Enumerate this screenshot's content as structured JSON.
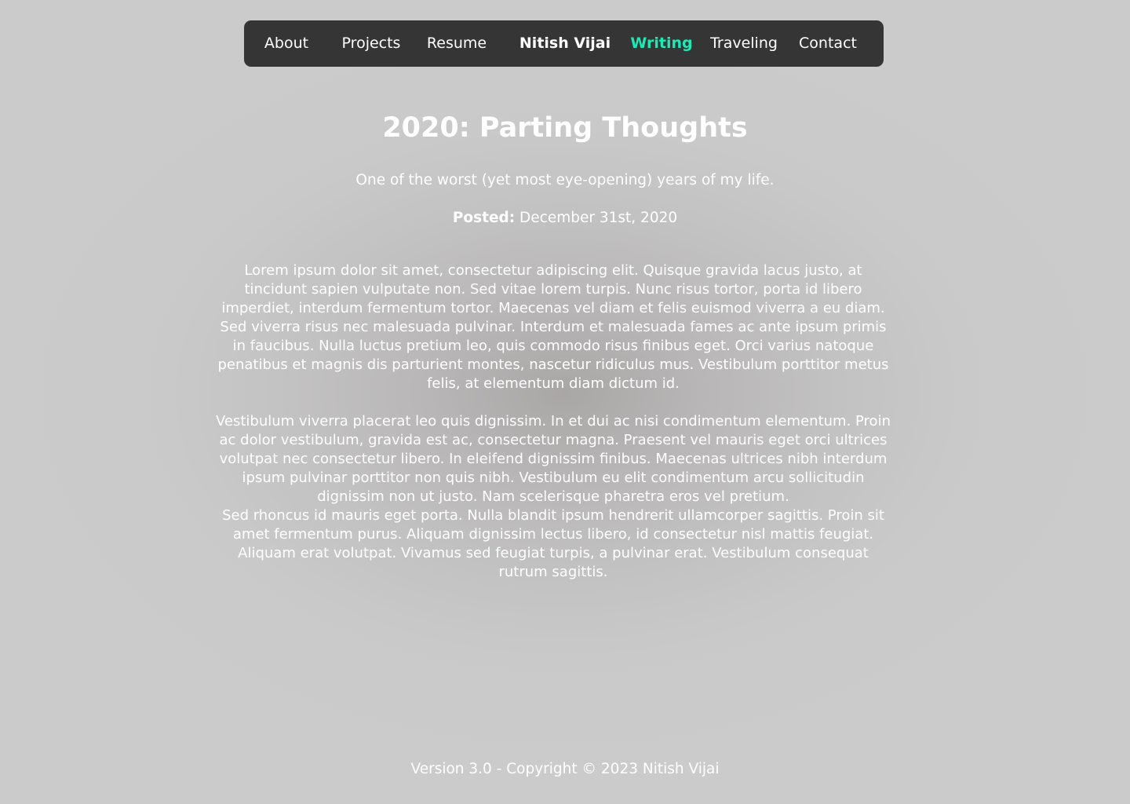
{
  "nav": {
    "items": [
      {
        "label": "About"
      },
      {
        "label": "Projects"
      },
      {
        "label": "Resume"
      },
      {
        "label": "Nitish Vijai"
      },
      {
        "label": "Writing"
      },
      {
        "label": "Traveling"
      },
      {
        "label": "Contact"
      }
    ],
    "active_label": "Writing",
    "active_color": "#1de9b6"
  },
  "article": {
    "title": "2020: Parting Thoughts",
    "subtitle": "One of the worst (yet most eye-opening) years of my life.",
    "posted_label": "Posted:",
    "posted_date": "December 31st, 2020",
    "paragraphs": [
      "Lorem ipsum dolor sit amet, consectetur adipiscing elit. Quisque gravida lacus justo, at tincidunt sapien vulputate non. Sed vitae lorem turpis. Nunc risus tortor, porta id libero imperdiet, interdum fermentum tortor. Maecenas vel diam et felis euismod viverra a eu diam. Sed viverra risus nec malesuada pulvinar. Interdum et malesuada fames ac ante ipsum primis in faucibus. Nulla luctus pretium leo, quis commodo risus finibus eget. Orci varius natoque penatibus et magnis dis parturient montes, nascetur ridiculus mus. Vestibulum porttitor metus felis, at elementum diam dictum id.",
      "Vestibulum viverra placerat leo quis dignissim. In et dui ac nisi condimentum elementum. Proin ac dolor vestibulum, gravida est ac, consectetur magna. Praesent vel mauris eget orci ultrices volutpat nec consectetur libero. In eleifend dignissim finibus. Maecenas ultrices nibh interdum ipsum pulvinar porttitor non quis nibh. Vestibulum eu elit condimentum arcu sollicitudin dignissim non ut justo. Nam scelerisque pharetra eros vel pretium.",
      "Sed rhoncus id mauris eget porta. Nulla blandit ipsum hendrerit ullamcorper sagittis. Proin sit amet fermentum purus. Aliquam dignissim lectus libero, id consectetur nisl mattis feugiat. Aliquam erat volutpat. Vivamus sed feugiat turpis, a pulvinar erat. Vestibulum consequat rutrum sagittis."
    ]
  },
  "footer": {
    "text": "Version 3.0 - Copyright © 2023 Nitish Vijai"
  }
}
